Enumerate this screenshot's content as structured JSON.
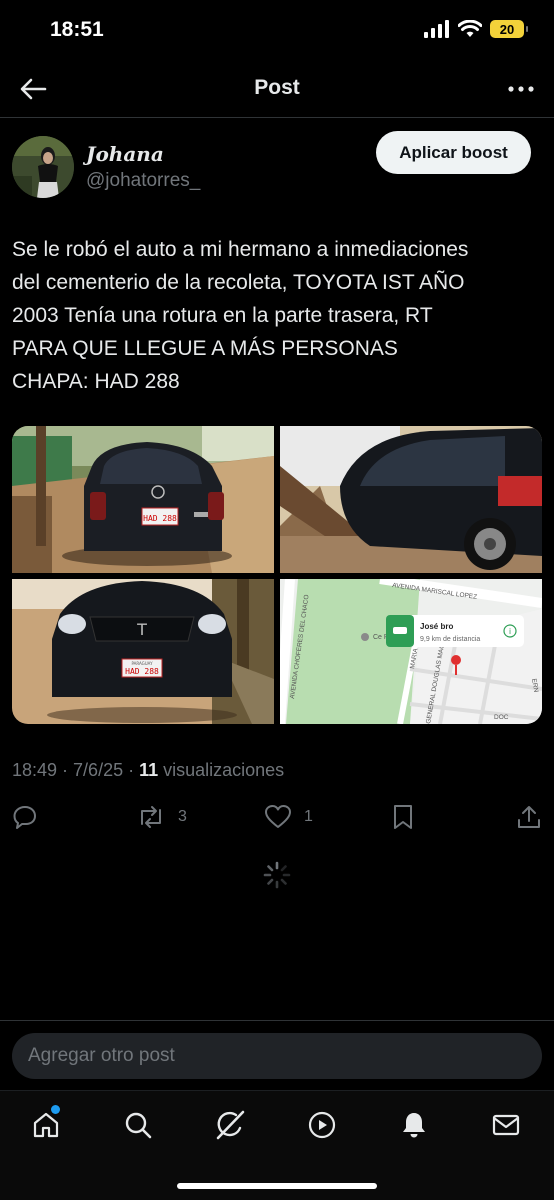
{
  "status_bar": {
    "time": "18:51",
    "battery": "20"
  },
  "header": {
    "title": "Post"
  },
  "author": {
    "name": "Johana",
    "handle": "@johatorres_"
  },
  "boost_button": {
    "label": "Aplicar boost"
  },
  "post": {
    "lines": [
      "Se le robó el auto a mi hermano a inmediaciones",
      "del cementerio de la recoleta, TOYOTA IST AÑO",
      "2003 Tenía una rotura en la parte trasera, RT",
      "PARA QUE LLEGUE A MÁS PERSONAS",
      "CHAPA: HAD 288"
    ]
  },
  "media": {
    "plate_text": "HAD 288",
    "plate_header": "PARAGUAY",
    "map": {
      "street_1": "AVENIDA MARISCAL LOPEZ",
      "street_2": "AVENIDA CHOFERES DEL CHACO",
      "street_3": "MARIA",
      "street_4": "GENERAL DOUGLAS MAC",
      "street_5": "ERN",
      "street_6": "DOC",
      "place_label": "Ce Re",
      "card_name": "José bro",
      "card_distance": "9,9 km de distancia"
    }
  },
  "meta": {
    "time": "18:49 · 7/6/25 · ",
    "views_count": "11",
    "views_label": " visualizaciones"
  },
  "actions": {
    "reposts": "3",
    "likes": "1"
  },
  "compose": {
    "placeholder": "Agregar otro post"
  },
  "colors": {
    "background": "#000000",
    "text": "#e7e9ea",
    "muted": "#71767b",
    "accent": "#1d9bf0",
    "divider": "#2f3336"
  },
  "icons": {
    "back": "arrow-left-icon",
    "more": "more-horizontal-icon",
    "reply": "reply-icon",
    "repost": "repost-icon",
    "like": "heart-icon",
    "bookmark": "bookmark-icon",
    "share": "share-icon",
    "nav": [
      "home-icon",
      "search-icon",
      "grok-icon",
      "video-icon",
      "notifications-icon",
      "messages-icon"
    ]
  }
}
